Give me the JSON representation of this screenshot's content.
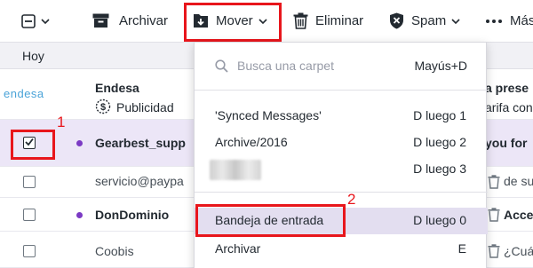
{
  "toolbar": {
    "archive_label": "Archivar",
    "move_label": "Mover",
    "delete_label": "Eliminar",
    "spam_label": "Spam",
    "more_label": "Más"
  },
  "group": {
    "label": "Hoy"
  },
  "messages": [
    {
      "sender": "Endesa",
      "subject": "a prese",
      "subject2": "arifa con",
      "ad_label": "Publicidad",
      "logo": "endesa"
    },
    {
      "sender": "Gearbest_supp",
      "subject": "you for"
    },
    {
      "sender": "servicio@paypa",
      "subject": "de su p"
    },
    {
      "sender": "DonDominio",
      "subject": "Acces"
    },
    {
      "sender": "Coobis",
      "subject": "¿Cuánt"
    }
  ],
  "dropdown": {
    "search_placeholder": "Busca una carpet",
    "search_shortcut": "Mayús+D",
    "folders": [
      {
        "label": "'Synced Messages'",
        "shortcut": "D luego 1"
      },
      {
        "label": "Archive/2016",
        "shortcut": "D luego 2"
      },
      {
        "label": "",
        "shortcut": "D luego 3"
      },
      {
        "label": "Bandeja de entrada",
        "shortcut": "D luego 0"
      },
      {
        "label": "Archivar",
        "shortcut": "E"
      }
    ]
  },
  "annotations": {
    "one": "1",
    "two": "2"
  },
  "colors": {
    "highlight": "#e8161c",
    "accent": "#7b3ac4",
    "selected_row": "#ece6f7"
  }
}
